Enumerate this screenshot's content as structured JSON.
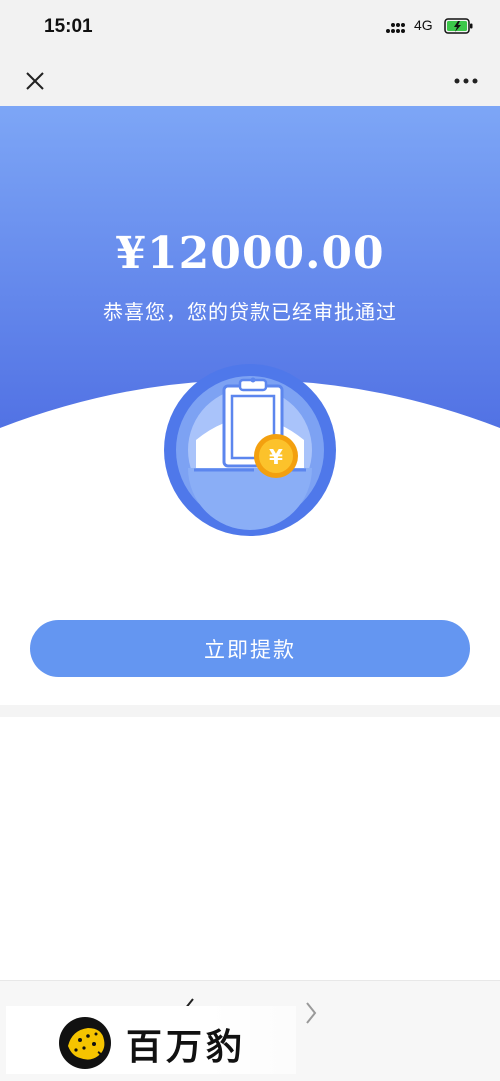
{
  "status_bar": {
    "time": "15:01",
    "network": "4G",
    "battery_color": "#3cc74a"
  },
  "nav": {
    "close_icon": "close-icon",
    "more_icon": "more-dots-icon"
  },
  "hero": {
    "amount": "¥12000.00",
    "message": "恭喜您，您的贷款已经审批通过",
    "gradient_top": "#7da6f6",
    "gradient_bottom": "#4f6fe3",
    "coin_symbol": "¥"
  },
  "action": {
    "withdraw_label": "立即提款",
    "button_color": "#6496f1"
  },
  "watermark": {
    "text": "百万豹"
  }
}
